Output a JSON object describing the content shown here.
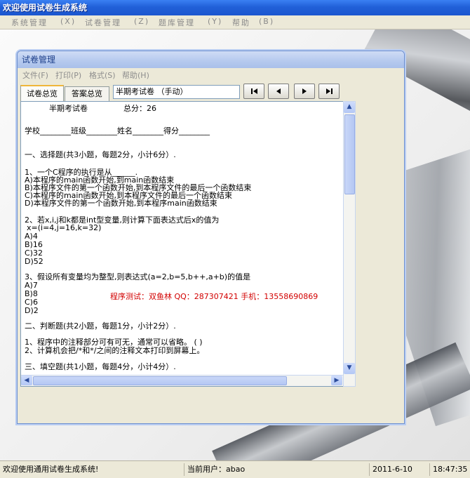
{
  "app": {
    "title": "欢迎使用试卷生成系统",
    "menu": [
      "系统管理",
      "(X)",
      "试卷管理",
      "(Z)",
      "题库管理",
      "(Y)",
      "帮助",
      "(B)"
    ]
  },
  "window": {
    "title": "试卷管理",
    "menu": [
      "文件(F)",
      "打印(P)",
      "格式(S)",
      "帮助(H)"
    ],
    "tabs": [
      "试卷总览",
      "答案总览"
    ],
    "mode_value": "半期考试卷 （手动）",
    "nav": {
      "first": "first-icon",
      "prev": "prev-icon",
      "next": "next-icon",
      "last": "last-icon"
    }
  },
  "paper": {
    "header": "半期考试卷",
    "total": "总分：26",
    "info": "学校________班级________姓名________得分________",
    "sec1": "一、选择题(共3小题，每题2分，小计6分）.",
    "q1": "1、一个C程序的执行是从______.",
    "q1a": "A)本程序的main函数开始,到main函数结束",
    "q1b": "B)本程序文件的第一个函数开始,到本程序文件的最后一个函数结束",
    "q1c": "C)本程序的main函数开始,到本程序文件的最后一个函数结束",
    "q1d": "D)本程序文件的第一个函数开始,到本程序main函数结束",
    "q2": "2、若x,i,j和k都是int型变量,则计算下面表达式后x的值为",
    "q2b": "x=(i=4,j=16,k=32)",
    "q2oa": "A)4",
    "q2ob": "B)16",
    "q2oc": "C)32",
    "q2od": "D)52",
    "q3": "3、假设所有变量均为整型,则表达式(a=2,b=5,b++,a+b)的值是",
    "q3oa": "A)7",
    "q3ob": "B)8",
    "q3oc": "C)6",
    "q3od": "D)2",
    "tester": "程序测试：双鱼林  QQ：287307421  手机：13558690869",
    "sec2": "二、判断题(共2小题，每题1分，小计2分）.",
    "j1": "1、程序中的注释部分可有可无，通常可以省略。 (   )",
    "j2": "2、计算机会把/*和*/之间的注释文本打印到屏幕上。",
    "sec3": "三、填空题(共1小题，每题4分，小计4分）."
  },
  "status": {
    "welcome": "欢迎使用通用试卷生成系统!",
    "user": "当前用户：abao",
    "date": "2011-6-10",
    "time": "18:47:35"
  },
  "colors": {
    "titlebar": "#2160d8",
    "tester_text": "#d20000"
  }
}
